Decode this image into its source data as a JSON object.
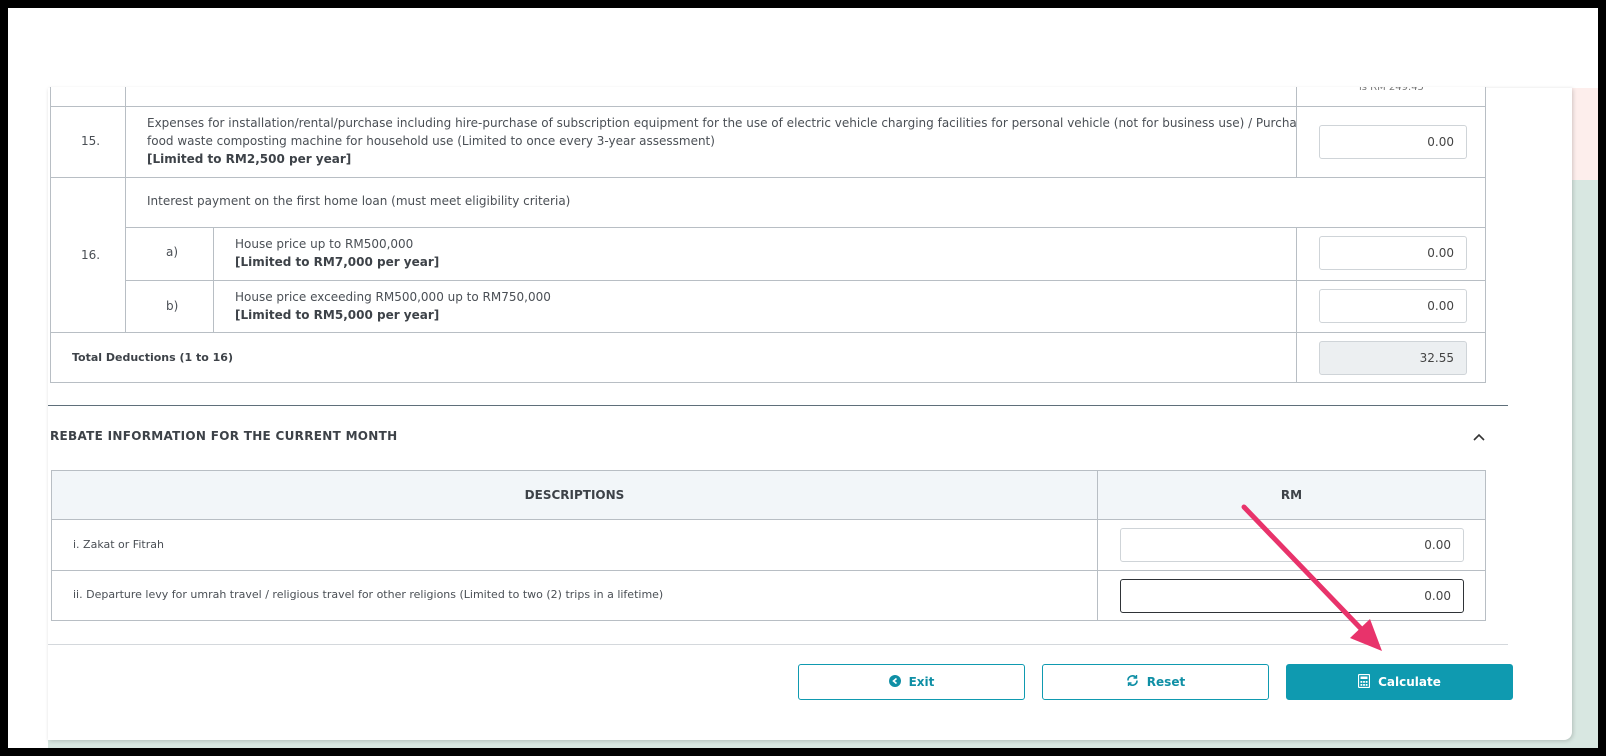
{
  "top_partial_text": "is RM 249.45",
  "items": {
    "item15": {
      "number": "15.",
      "line1": "Expenses for installation/rental/purchase including hire-purchase of subscription equipment for the use of electric vehicle charging facilities for personal vehicle (not for business use) / Purchase of",
      "line2": "food waste composting machine for household use (Limited to once every 3-year assessment)",
      "limit": "[Limited to RM2,500 per year]",
      "value": "0.00"
    },
    "item16": {
      "number": "16.",
      "description": "Interest payment on the first home loan (must meet eligibility criteria)",
      "a": {
        "label": "a)",
        "description": "House price up to RM500,000",
        "limit": "[Limited to RM7,000 per year]",
        "value": "0.00"
      },
      "b": {
        "label": "b)",
        "description": "House price exceeding RM500,000 up to RM750,000",
        "limit": "[Limited to RM5,000 per year]",
        "value": "0.00"
      }
    },
    "total": {
      "label": "Total Deductions (1 to 16)",
      "value": "32.55"
    }
  },
  "rebate": {
    "title": "REBATE INFORMATION FOR THE CURRENT MONTH",
    "col_descriptions": "DESCRIPTIONS",
    "col_rm": "RM",
    "rows": [
      {
        "label": "i. Zakat or Fitrah",
        "value": "0.00"
      },
      {
        "label": "ii. Departure levy for umrah travel / religious travel for other religions (Limited to two (2) trips in a lifetime)",
        "value": "0.00"
      }
    ]
  },
  "buttons": {
    "exit": "Exit",
    "reset": "Reset",
    "calculate": "Calculate"
  },
  "colors": {
    "accent": "#0f9ab0",
    "arrow": "#e8336b"
  },
  "icons": {
    "exit": "circle-arrow-left-icon",
    "reset": "refresh-icon",
    "calculate": "calculator-icon",
    "collapse": "chevron-up-icon"
  }
}
